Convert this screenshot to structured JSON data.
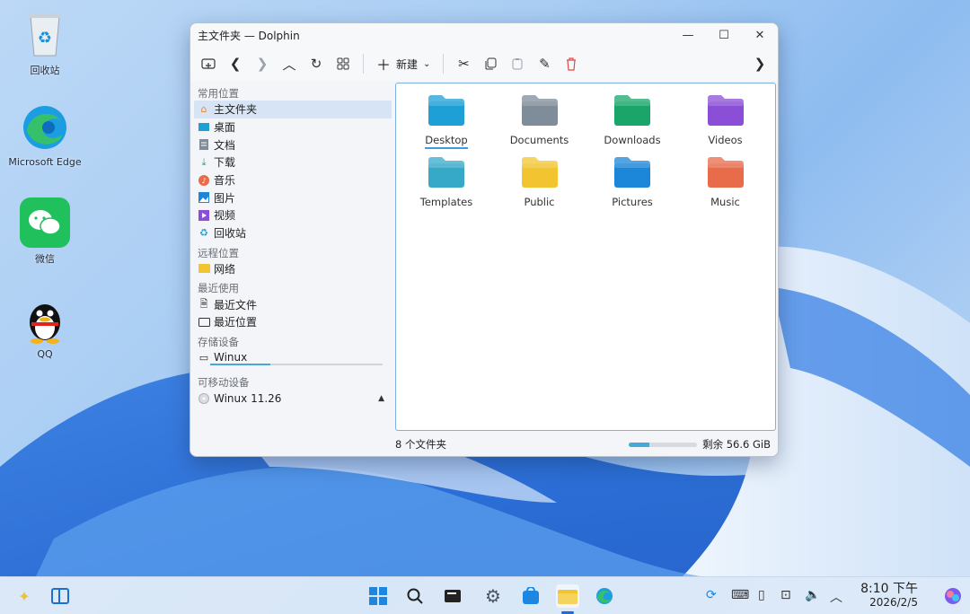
{
  "desktop": {
    "icons": [
      {
        "label": "回收站",
        "icon": "recycle-bin-icon"
      },
      {
        "label": "Microsoft Edge",
        "icon": "edge-icon"
      },
      {
        "label": "微信",
        "icon": "wechat-icon"
      },
      {
        "label": "QQ",
        "icon": "qq-icon"
      }
    ]
  },
  "window": {
    "title": "主文件夹 — Dolphin",
    "toolbar": {
      "new_label": "新建"
    },
    "sidebar": {
      "sections": [
        {
          "title": "常用位置",
          "items": [
            {
              "label": "主文件夹",
              "icon": "home-icon",
              "active": true
            },
            {
              "label": "桌面",
              "icon": "desktop-icon"
            },
            {
              "label": "文档",
              "icon": "document-icon"
            },
            {
              "label": "下载",
              "icon": "download-icon"
            },
            {
              "label": "音乐",
              "icon": "music-icon"
            },
            {
              "label": "图片",
              "icon": "picture-icon"
            },
            {
              "label": "视频",
              "icon": "video-icon"
            },
            {
              "label": "回收站",
              "icon": "trash-icon"
            }
          ]
        },
        {
          "title": "远程位置",
          "items": [
            {
              "label": "网络",
              "icon": "network-folder-icon"
            }
          ]
        },
        {
          "title": "最近使用",
          "items": [
            {
              "label": "最近文件",
              "icon": "recent-files-icon"
            },
            {
              "label": "最近位置",
              "icon": "recent-locations-icon"
            }
          ]
        },
        {
          "title": "存储设备",
          "items": [
            {
              "label": "Winux",
              "icon": "drive-icon"
            }
          ]
        },
        {
          "title": "可移动设备",
          "items": [
            {
              "label": "Winux 11.26",
              "icon": "disc-icon"
            }
          ]
        }
      ]
    },
    "files": [
      {
        "name": "Desktop",
        "color": "#1e9fd6",
        "icon": "desktop-folder-icon"
      },
      {
        "name": "Documents",
        "color": "#7f8c99",
        "icon": "documents-folder-icon"
      },
      {
        "name": "Downloads",
        "color": "#1aa66b",
        "icon": "downloads-folder-icon"
      },
      {
        "name": "Videos",
        "color": "#8a4fd6",
        "icon": "videos-folder-icon"
      },
      {
        "name": "Templates",
        "color": "#36a9c9",
        "icon": "templates-folder-icon"
      },
      {
        "name": "Public",
        "color": "#f2c530",
        "icon": "public-folder-icon"
      },
      {
        "name": "Pictures",
        "color": "#1c86d8",
        "icon": "pictures-folder-icon"
      },
      {
        "name": "Music",
        "color": "#e86b4a",
        "icon": "music-folder-icon"
      }
    ],
    "status": {
      "count": "8 个文件夹",
      "free": "剩余 56.6 GiB",
      "used_fraction": 0.3
    }
  },
  "taskbar": {
    "time": "8:10 下午",
    "date": "2026/2/5"
  }
}
